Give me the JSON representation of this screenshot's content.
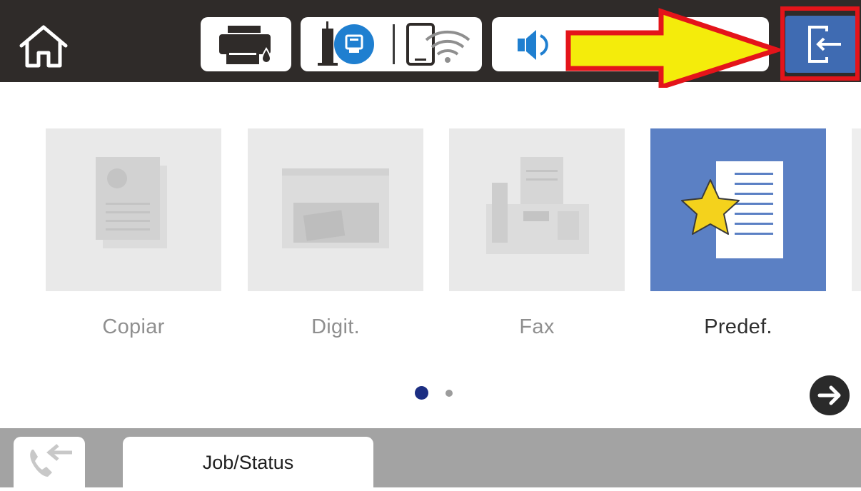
{
  "topbar": {
    "icons": {
      "home": "home-icon",
      "printer": "printer-ink-icon",
      "network": "network-icon",
      "wifi": "wifi-icon",
      "volume": "volume-icon",
      "logout": "logout-icon",
      "annotation": "yellow-arrow-icon"
    },
    "colors": {
      "bar": "#2f2b29",
      "logout_button": "#3f6bb2",
      "highlight": "#e4141a",
      "arrow_fill": "#f4ec0b"
    }
  },
  "tiles": [
    {
      "label": "Copiar",
      "icon": "copy-document-icon",
      "enabled": false
    },
    {
      "label": "Digit.",
      "icon": "scanner-icon",
      "enabled": false
    },
    {
      "label": "Fax",
      "icon": "fax-icon",
      "enabled": false
    },
    {
      "label": "Predef.",
      "icon": "preset-star-document-icon",
      "enabled": true
    }
  ],
  "pagination": {
    "current_page": 1,
    "total_pages": 2
  },
  "bottombar": {
    "job_status_label": "Job/Status",
    "call_icon": "phone-forward-icon"
  },
  "colors": {
    "accent": "#5b80c4",
    "disabled_tile": "#e9e9e9",
    "active_dot": "#1c2e82"
  }
}
